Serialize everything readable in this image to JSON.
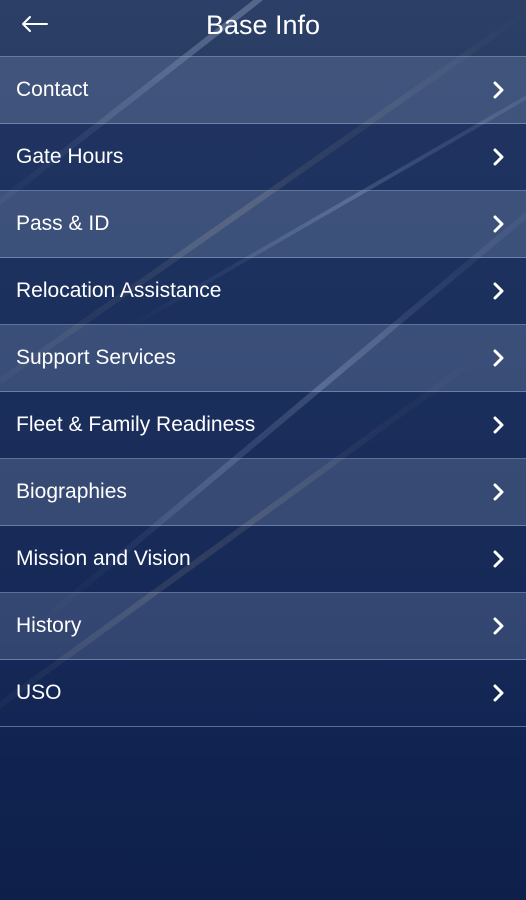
{
  "header": {
    "title": "Base Info",
    "back_icon": "arrow-left-icon"
  },
  "menu": {
    "items": [
      {
        "label": "Contact"
      },
      {
        "label": "Gate Hours"
      },
      {
        "label": "Pass & ID"
      },
      {
        "label": "Relocation Assistance"
      },
      {
        "label": "Support Services"
      },
      {
        "label": "Fleet & Family Readiness"
      },
      {
        "label": "Biographies"
      },
      {
        "label": "Mission and Vision"
      },
      {
        "label": "History"
      },
      {
        "label": "USO"
      }
    ],
    "chevron_icon": "chevron-right-icon"
  },
  "colors": {
    "background_top": "#2c3f66",
    "background_bottom": "#0e1f4a",
    "text": "#ffffff"
  }
}
